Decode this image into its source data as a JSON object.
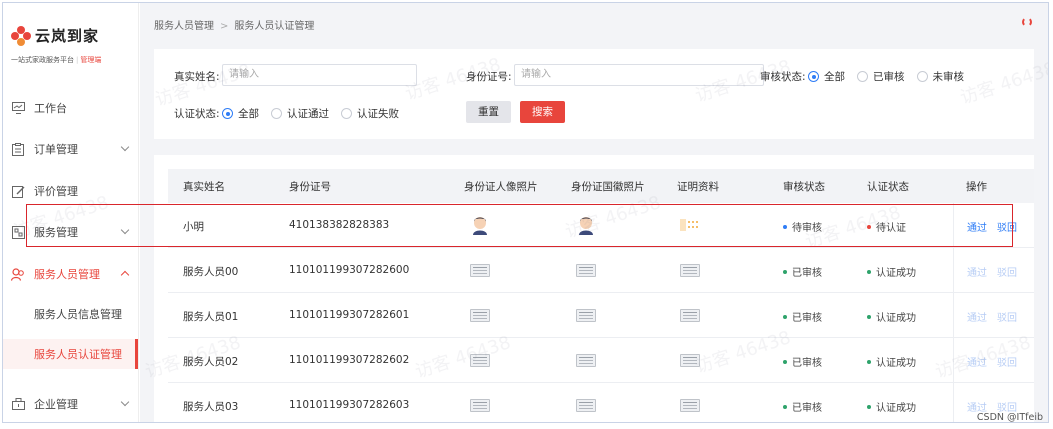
{
  "brand": {
    "name": "云岚到家",
    "slogan_main": "一站式家政服务平台",
    "slogan_role": "管理端"
  },
  "sidebar": {
    "items": [
      {
        "label": "工作台",
        "icon": "monitor-icon"
      },
      {
        "label": "订单管理",
        "icon": "clipboard-icon"
      },
      {
        "label": "评价管理",
        "icon": "edit-icon"
      },
      {
        "label": "服务管理",
        "icon": "service-icon"
      },
      {
        "label": "服务人员管理",
        "icon": "people-icon"
      },
      {
        "label": "企业管理",
        "icon": "building-icon"
      }
    ],
    "subitems": [
      {
        "label": "服务人员信息管理"
      },
      {
        "label": "服务人员认证管理"
      }
    ]
  },
  "breadcrumb": {
    "parent": "服务人员管理",
    "current": "服务人员认证管理"
  },
  "filter": {
    "name_label": "真实姓名:",
    "name_placeholder": "请输入",
    "id_label": "身份证号:",
    "id_placeholder": "请输入",
    "audit_label": "审核状态:",
    "audit_options": [
      "全部",
      "已审核",
      "未审核"
    ],
    "cert_label": "认证状态:",
    "cert_options": [
      "全部",
      "认证通过",
      "认证失败"
    ],
    "reset": "重置",
    "search": "搜索"
  },
  "table": {
    "headers": [
      "真实姓名",
      "身份证号",
      "身份证人像照片",
      "身份证国徽照片",
      "证明资料",
      "审核状态",
      "认证状态",
      "操作"
    ],
    "rows": [
      {
        "name": "小明",
        "id": "410138382828383",
        "audit": "待审核",
        "cert": "待认证",
        "approve": "通过",
        "reject": "驳回"
      },
      {
        "name": "服务人员00",
        "id": "110101199307282600",
        "audit": "已审核",
        "cert": "认证成功",
        "approve": "通过",
        "reject": "驳回"
      },
      {
        "name": "服务人员01",
        "id": "110101199307282601",
        "audit": "已审核",
        "cert": "认证成功",
        "approve": "通过",
        "reject": "驳回"
      },
      {
        "name": "服务人员02",
        "id": "110101199307282602",
        "audit": "已审核",
        "cert": "认证成功",
        "approve": "通过",
        "reject": "驳回"
      },
      {
        "name": "服务人员03",
        "id": "110101199307282603",
        "audit": "已审核",
        "cert": "认证成功",
        "approve": "通过",
        "reject": "驳回"
      }
    ]
  },
  "watermark": "访客 46438",
  "footer_credit": "CSDN @ITfeib",
  "colors": {
    "accent": "#e8453c",
    "link": "#2f7df6",
    "pending": "#2f7df6",
    "fail": "#e8453c",
    "success": "#2ea36b"
  }
}
